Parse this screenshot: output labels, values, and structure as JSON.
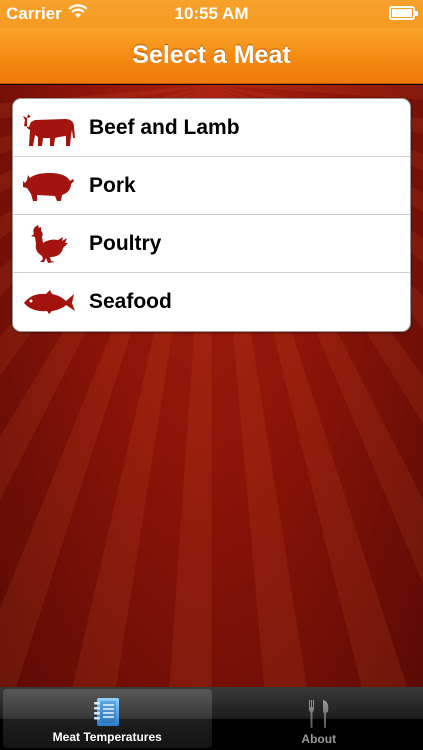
{
  "status_bar": {
    "carrier": "Carrier",
    "time": "10:55 AM",
    "icons": [
      "wifi-icon",
      "battery-icon"
    ]
  },
  "nav_bar": {
    "title": "Select a Meat"
  },
  "colors": {
    "accent_orange": "#f48a12",
    "icon_red": "#a3140f",
    "background_red": "#8c1408",
    "tab_selected_blue": "#4fa3e6"
  },
  "meat_list": [
    {
      "label": "Beef and Lamb",
      "icon": "cow-icon"
    },
    {
      "label": "Pork",
      "icon": "pig-icon"
    },
    {
      "label": "Poultry",
      "icon": "chicken-icon"
    },
    {
      "label": "Seafood",
      "icon": "fish-icon"
    }
  ],
  "tab_bar": {
    "tabs": [
      {
        "label": "Meat Temperatures",
        "icon": "notebook-icon",
        "selected": true
      },
      {
        "label": "About",
        "icon": "fork-knife-icon",
        "selected": false
      }
    ]
  }
}
